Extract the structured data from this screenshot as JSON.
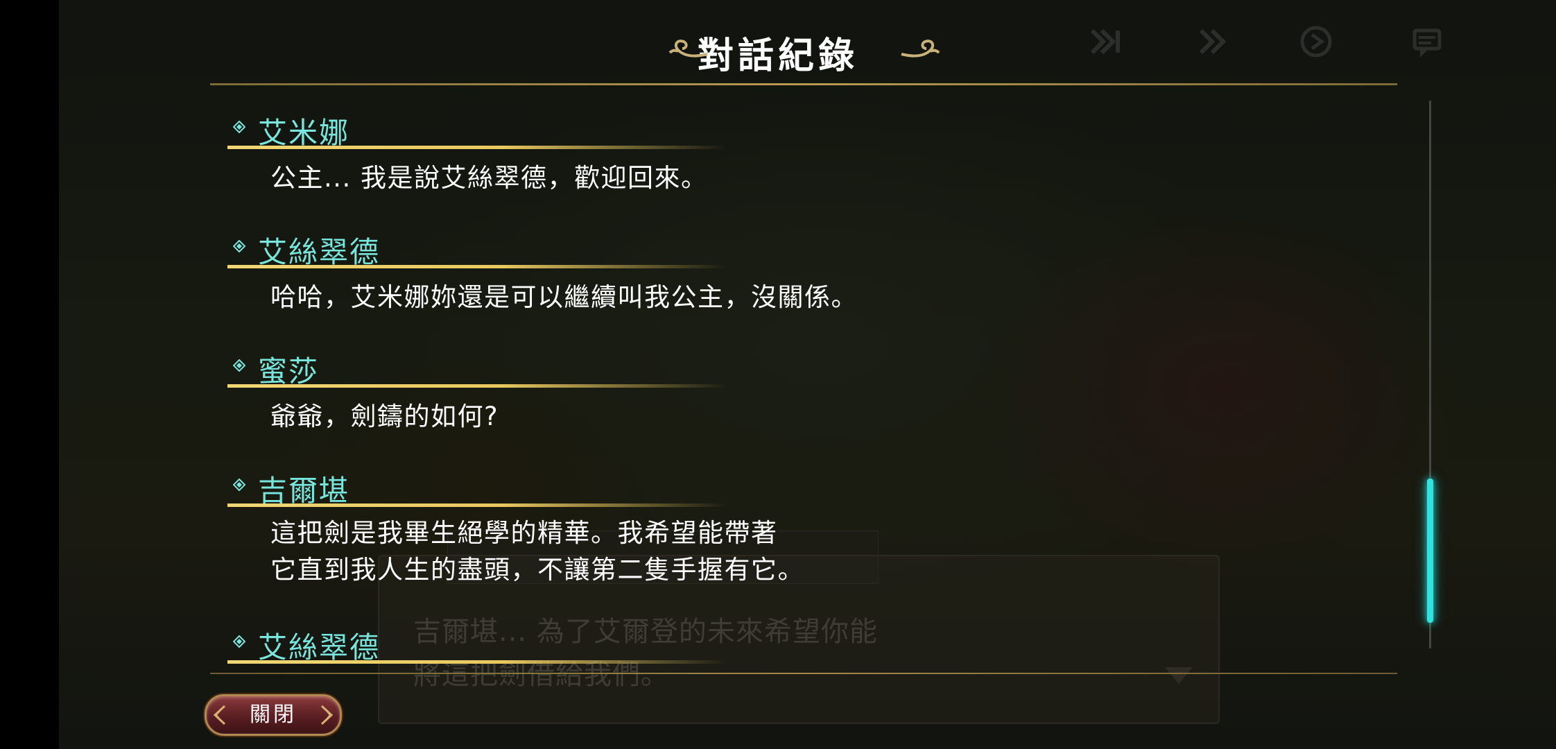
{
  "header": {
    "title": "對話紀錄"
  },
  "toolbar_icons": [
    "skip-all-icon",
    "fast-forward-icon",
    "auto-play-icon",
    "log-icon"
  ],
  "dialogue_log": [
    {
      "speaker": "艾米娜",
      "lines": [
        "公主... 我是說艾絲翠德，歡迎回來。"
      ]
    },
    {
      "speaker": "艾絲翠德",
      "lines": [
        "哈哈，艾米娜妳還是可以繼續叫我公主，沒關係。"
      ]
    },
    {
      "speaker": "蜜莎",
      "lines": [
        "爺爺，劍鑄的如何?"
      ]
    },
    {
      "speaker": "吉爾堪",
      "lines": [
        "這把劍是我畢生絕學的精華。我希望能帶著",
        "它直到我人生的盡頭，不讓第二隻手握有它。"
      ]
    },
    {
      "speaker": "艾絲翠德",
      "lines": []
    }
  ],
  "background_dialog": {
    "lines": [
      "吉爾堪... 為了艾爾登的未來希望你能",
      "將這把劍借給我們。"
    ]
  },
  "footer": {
    "close_label": "關閉"
  },
  "scroll": {
    "position": 0.72
  },
  "colors": {
    "speaker": "#79e6de",
    "underline": "#f1d774",
    "accent": "#35e0dd",
    "button": "#5a1e22"
  }
}
